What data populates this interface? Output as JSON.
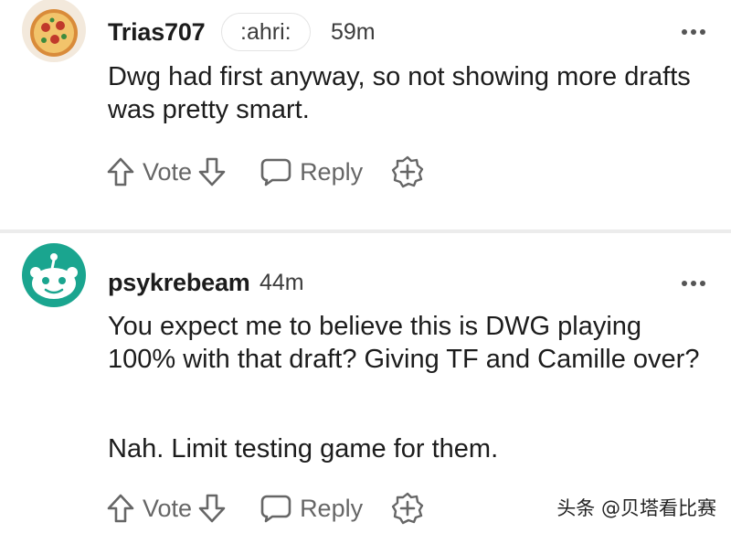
{
  "comments": [
    {
      "username": "Trias707",
      "flair": ":ahri:",
      "time": "59m",
      "avatar_icon": "pizza-avatar-icon",
      "paragraphs": [
        "Dwg had first anyway, so not showing more drafts was pretty smart."
      ],
      "actions": {
        "vote_label": "Vote",
        "reply_label": "Reply"
      }
    },
    {
      "username": "psykrebeam",
      "time": "44m",
      "avatar_icon": "snoo-avatar-icon",
      "paragraphs": [
        "You expect me to believe this is DWG playing 100% with that draft? Giving TF and Camille over?",
        "Nah. Limit testing game for them."
      ],
      "actions": {
        "vote_label": "Vote",
        "reply_label": "Reply"
      }
    }
  ],
  "watermark": "头条 @贝塔看比赛",
  "colors": {
    "icon_gray": "#666666",
    "snoo_teal": "#1aa58f"
  }
}
